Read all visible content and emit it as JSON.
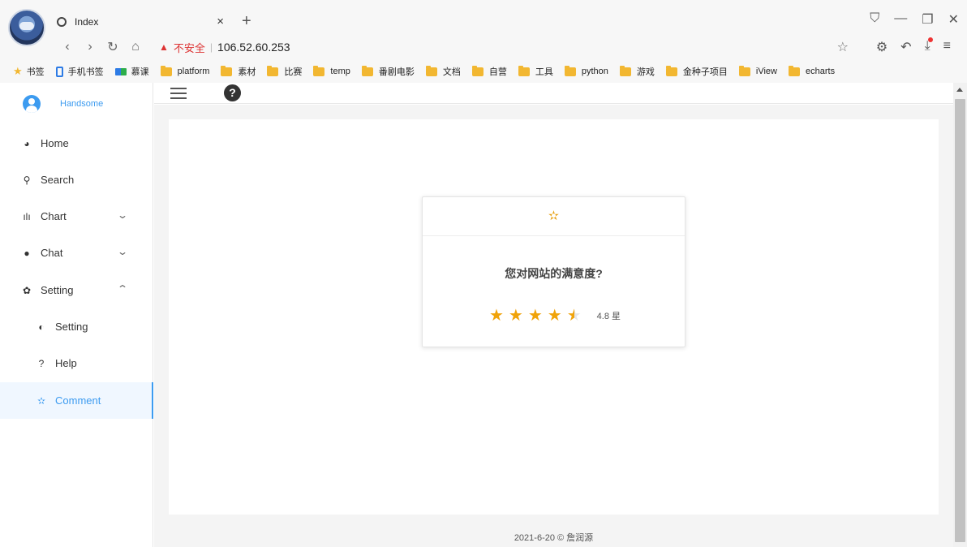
{
  "browser": {
    "tab_title": "Index",
    "tab_close": "×",
    "new_tab": "+",
    "win_controls": [
      "⛉",
      "—",
      "❐",
      "✕"
    ],
    "nav": {
      "back": "‹",
      "forward": "›",
      "reload": "↻",
      "home": "⌂"
    },
    "address": {
      "insecure_label": "不安全",
      "separator": "|",
      "url": "106.52.60.253",
      "star": "☆"
    },
    "right_icons": {
      "extensions": "⚙",
      "undo": "↶",
      "download": "⤓",
      "menu": "≡"
    },
    "bookmarks": [
      {
        "label": "书签",
        "icon": "star"
      },
      {
        "label": "手机书签",
        "icon": "phone"
      },
      {
        "label": "慕课",
        "icon": "flag"
      },
      {
        "label": "platform",
        "icon": "folder"
      },
      {
        "label": "素材",
        "icon": "folder"
      },
      {
        "label": "比赛",
        "icon": "folder"
      },
      {
        "label": "temp",
        "icon": "folder"
      },
      {
        "label": "番剧电影",
        "icon": "folder"
      },
      {
        "label": "文档",
        "icon": "folder"
      },
      {
        "label": "自营",
        "icon": "folder"
      },
      {
        "label": "工具",
        "icon": "folder"
      },
      {
        "label": "python",
        "icon": "folder"
      },
      {
        "label": "游戏",
        "icon": "folder"
      },
      {
        "label": "金种子项目",
        "icon": "folder"
      },
      {
        "label": "iView",
        "icon": "folder"
      },
      {
        "label": "echarts",
        "icon": "folder"
      }
    ]
  },
  "sidebar": {
    "user_name": "Handsome",
    "items": [
      {
        "label": "Home",
        "icon": "◕"
      },
      {
        "label": "Search",
        "icon": "⚲",
        "icon_glyph": "Q"
      },
      {
        "label": "Chart",
        "icon": "ılı",
        "arrow": "⌄"
      },
      {
        "label": "Chat",
        "icon": "●",
        "arrow": "⌄"
      },
      {
        "label": "Setting",
        "icon": "✿",
        "arrow": "⌃"
      },
      {
        "label": "Setting",
        "icon": "◐"
      },
      {
        "label": "Help",
        "icon": "?"
      },
      {
        "label": "Comment",
        "icon": "✫"
      }
    ]
  },
  "header": {
    "help_symbol": "?"
  },
  "rating": {
    "head_icon": "✫",
    "question": "您对网站的满意度?",
    "value_text": "4.8 星",
    "value": 4.8,
    "max": 5,
    "star_color": "#f0a30a"
  },
  "footer": {
    "text": "2021-6-20 © 詹润源"
  },
  "colors": {
    "accent": "#3c9bf0",
    "warning": "#dd3333",
    "folder": "#f2b731"
  }
}
